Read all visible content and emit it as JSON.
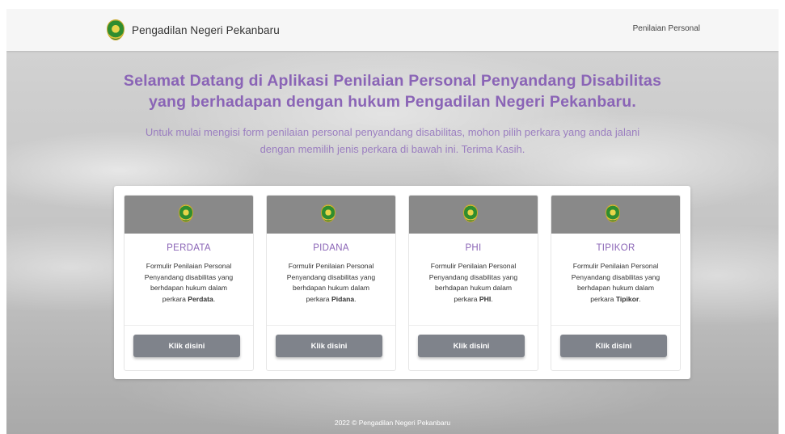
{
  "navbar": {
    "brand": "Pengadilan Negeri Pekanbaru",
    "link": "Penilaian Personal"
  },
  "hero": {
    "title_line1": "Selamat Datang di Aplikasi Penilaian Personal Penyandang Disabilitas",
    "title_line2": "yang berhadapan dengan hukum Pengadilan Negeri Pekanbaru.",
    "subtitle_line1": "Untuk mulai mengisi form penilaian personal penyandang disabilitas, mohon pilih perkara yang anda jalani",
    "subtitle_line2": "dengan memilih jenis perkara di bawah ini. Terima Kasih."
  },
  "cards": [
    {
      "title": "PERDATA",
      "desc_line1": "Formulir Penilaian Personal",
      "desc_line2": "Penyandang disabilitas yang",
      "desc_line3": "berhdapan hukum dalam",
      "desc_prefix": "perkara ",
      "desc_bold": "Perdata",
      "desc_suffix": ".",
      "button": "Klik disini"
    },
    {
      "title": "PIDANA",
      "desc_line1": "Formulir Penilaian Personal",
      "desc_line2": "Penyandang disabilitas yang",
      "desc_line3": "berhdapan hukum dalam",
      "desc_prefix": "perkara ",
      "desc_bold": "Pidana",
      "desc_suffix": ".",
      "button": "Klik disini"
    },
    {
      "title": "PHI",
      "desc_line1": "Formulir Penilaian Personal",
      "desc_line2": "Penyandang disabilitas yang",
      "desc_line3": "berhdapan hukum dalam",
      "desc_prefix": "perkara ",
      "desc_bold": "PHI",
      "desc_suffix": ".",
      "button": "Klik disini"
    },
    {
      "title": "TIPIKOR",
      "desc_line1": "Formulir Penilaian Personal",
      "desc_line2": "Penyandang disabilitas yang",
      "desc_line3": "berhdapan hukum dalam",
      "desc_prefix": "perkara ",
      "desc_bold": "Tipikor",
      "desc_suffix": ".",
      "button": "Klik disini"
    }
  ],
  "footer": {
    "text": "2022 © Pengadilan Negeri Pekanbaru"
  },
  "colors": {
    "accent": "#8a64b6",
    "card_header": "#898989",
    "button": "#7f838b"
  }
}
